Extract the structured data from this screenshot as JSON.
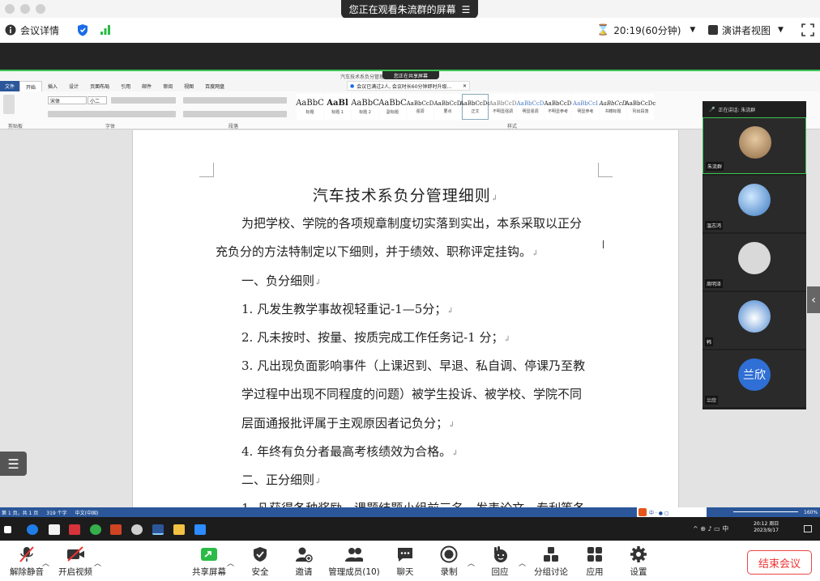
{
  "top": {
    "share_banner": "您正在观看朱流群的屏幕",
    "meeting_info": "会议详情",
    "timer": "20:19(60分钟)",
    "view_mode": "演讲者视图"
  },
  "word": {
    "title_text": "汽车技术系负分管理细则.docx",
    "share_label": "您正在共享屏幕",
    "notification": "会议已满过2人, 会议时长60分钟即时升级...",
    "menu": [
      "文件",
      "开始",
      "插入",
      "设计",
      "页面布局",
      "引用",
      "邮件",
      "审阅",
      "视图",
      "百度网盘"
    ],
    "font_name": "宋体",
    "font_size": "小二",
    "group_clipboard": "剪贴板",
    "group_font": "字体",
    "group_paragraph": "段落",
    "group_styles": "样式",
    "styles": [
      {
        "preview": "AaBbC",
        "name": "标题"
      },
      {
        "preview": "AaBl",
        "name": "标题 1"
      },
      {
        "preview": "AaBbC",
        "name": "标题 2"
      },
      {
        "preview": "AaBbC",
        "name": "副标题"
      },
      {
        "preview": "AaBbCcD",
        "name": "强调"
      },
      {
        "preview": "AaBbCcD",
        "name": "要点"
      },
      {
        "preview": "AaBbCcDc",
        "name": "正文"
      },
      {
        "preview": "AaBbCcD",
        "name": "不明显强调"
      },
      {
        "preview": "AaBbCcD",
        "name": "明显强调"
      },
      {
        "preview": "AaBbCcD",
        "name": "不明显参考"
      },
      {
        "preview": "AaBbCcI",
        "name": "明显参考"
      },
      {
        "preview": "AaBbCcD",
        "name": "书籍标题"
      },
      {
        "preview": "AaBbCcDc",
        "name": "列出段落"
      }
    ],
    "doc_title": "汽车技术系负分管理细则",
    "paragraphs": [
      "为把学校、学院的各项规章制度切实落到实出，本系采取以正分",
      "充负分的方法特制定以下细则，并于绩效、职称评定挂钩。",
      "一、负分细则",
      "1. 凡发生教学事故视轻重记-1—5分；",
      "2. 凡未按时、按量、按质完成工作任务记-1 分；",
      "3. 凡出现负面影响事件（上课迟到、早退、私自调、停课乃至教",
      "学过程中出现不同程度的问题）被学生投诉、被学校、学院不同",
      "层面通报批评属于主观原因者记负分；",
      "4. 年终有负分者最高考核绩效为合格。",
      "二、正分细则",
      "1. 凡获得各种奖励、课题结题小组前三名、发表论文、专利等各"
    ],
    "status_page": "第 1 页，共 1 页",
    "status_words": "319 个字",
    "status_lang": "中文(中国)",
    "zoom": "160%",
    "clock_time": "20:12 周日",
    "clock_date": "2023/9/17"
  },
  "gallery": {
    "speaking_label": "正在讲话: 朱流群",
    "participants": [
      {
        "name": "朱流群",
        "avatar_color": "#caa57a"
      },
      {
        "name": "温志鸿",
        "avatar_color": "#4a8fd0"
      },
      {
        "name": "周明泽",
        "avatar_color": "#d9d9d9"
      },
      {
        "name": "韩",
        "avatar_color": "#3f7fce"
      },
      {
        "name": "兰欣",
        "avatar_color": "#2f6fd6",
        "initials": "兰欣"
      }
    ]
  },
  "toolbar": {
    "mute": "解除静音",
    "video": "开启视频",
    "share": "共享屏幕",
    "security": "安全",
    "invite": "邀请",
    "participants": "管理成员(10)",
    "chat": "聊天",
    "record": "录制",
    "reactions": "回应",
    "breakout": "分组讨论",
    "apps": "应用",
    "settings": "设置",
    "end": "结束会议"
  },
  "colors": {
    "accent_green": "#3ac451",
    "word_blue": "#2b579a",
    "end_red": "#e33333"
  }
}
